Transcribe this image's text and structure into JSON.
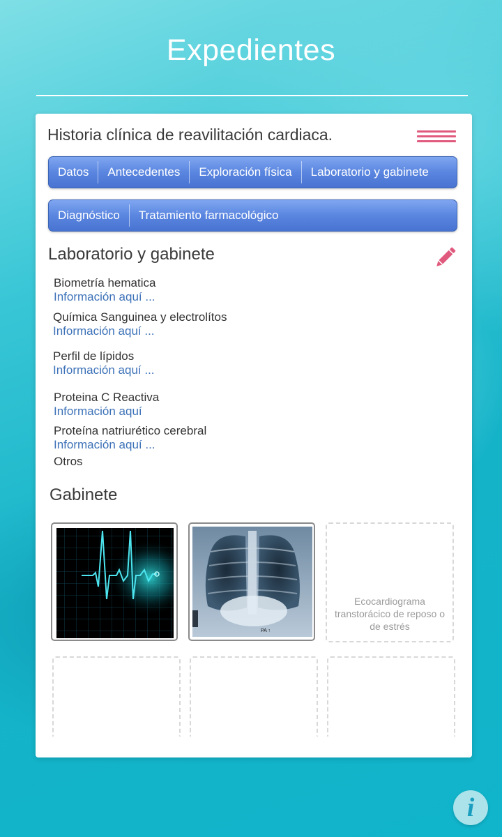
{
  "header": {
    "title": "Expedientes"
  },
  "card": {
    "title": "Historia clínica de reavilitación cardiaca.",
    "tabs_row1": [
      "Datos",
      "Antecedentes",
      "Exploración física",
      "Laboratorio y gabinete"
    ],
    "tabs_row2": [
      "Diagnóstico",
      "Tratamiento farmacológico"
    ],
    "active_tab": "Laboratorio y gabinete"
  },
  "laboratorio": {
    "title": "Laboratorio y gabinete",
    "items": [
      {
        "name": "Biometría hematica",
        "info": "Información aquí ..."
      },
      {
        "name": "Química Sanguinea y electrolítos",
        "info": "Información aquí ..."
      },
      {
        "name": "Perfil de lípidos",
        "info": "Información aquí ..."
      },
      {
        "name": "Proteina C Reactiva",
        "info": "Información aquí"
      },
      {
        "name": "Proteína natriurético cerebral",
        "info": "Información aquí ..."
      },
      {
        "name": "Otros",
        "info": ""
      }
    ]
  },
  "gabinete": {
    "title": "Gabinete",
    "images": [
      {
        "kind": "ecg-image"
      },
      {
        "kind": "chest-xray-image",
        "caption": "PA ↑"
      }
    ],
    "slots": [
      {
        "label": "Ecocardiograma transtorácico de reposo o de estrés"
      },
      {
        "label": ""
      },
      {
        "label": ""
      },
      {
        "label": ""
      }
    ]
  },
  "colors": {
    "accent_pink": "#e05a7e",
    "tab_blue": "#5a86e0",
    "link_blue": "#3d72b8"
  },
  "icons": {
    "menu": "hamburger-icon",
    "edit": "pencil-icon",
    "info": "info-icon"
  }
}
